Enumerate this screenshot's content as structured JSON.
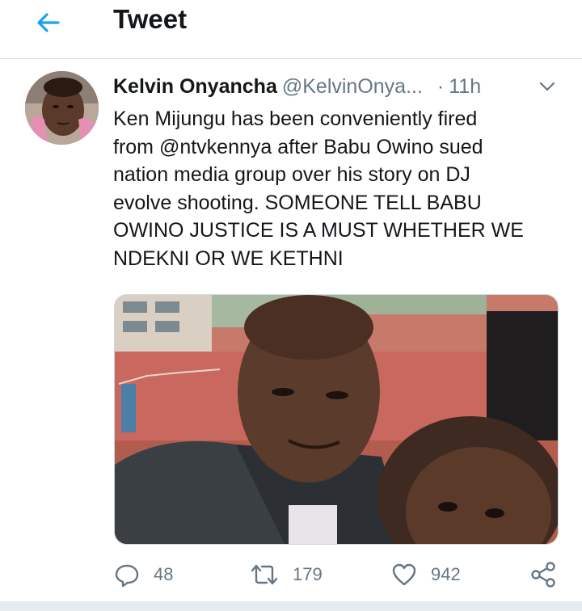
{
  "header": {
    "title": "Tweet",
    "back_icon": "arrow-left-icon",
    "accent_color": "#1da1f2"
  },
  "tweet": {
    "author_name": "Kelvin Onyancha",
    "author_handle": "@KelvinOnya...",
    "separator": "·",
    "time": "11h",
    "text": "Ken Mijungu has been conveniently fired\nfrom @ntvkennya after Babu Owino sued\nnation media group over his story on DJ\nevolve shooting. SOMEONE TELL BABU\nOWINO JUSTICE IS A MUST WHETHER WE\nNDEKNI OR WE KETHNI"
  },
  "actions": {
    "reply_count": "48",
    "retweet_count": "179",
    "like_count": "942"
  }
}
